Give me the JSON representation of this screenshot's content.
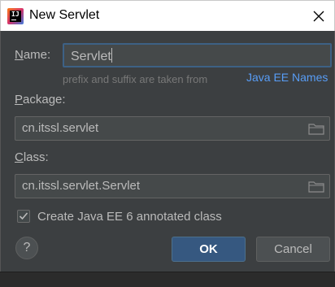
{
  "window": {
    "title": "New Servlet"
  },
  "form": {
    "name_label_mnemonic": "N",
    "name_label_rest": "ame:",
    "name_value": "Servlet",
    "hint": "prefix and suffix are taken from",
    "java_ee_link": "Java EE Names",
    "package_label_mnemonic": "P",
    "package_label_rest": "ackage:",
    "package_value": "cn.itssl.servlet",
    "class_label_mnemonic": "C",
    "class_label_rest": "lass:",
    "class_value": "cn.itssl.servlet.Servlet",
    "annotated_checkbox_checked": true,
    "annotated_checkbox_label": "Create Java EE 6 annotated class"
  },
  "buttons": {
    "help": "?",
    "ok": "OK",
    "cancel": "Cancel"
  },
  "icons": {
    "app": "intellij-idea-icon",
    "close": "close-icon",
    "browse": "folder-icon",
    "check": "checkmark-icon"
  }
}
